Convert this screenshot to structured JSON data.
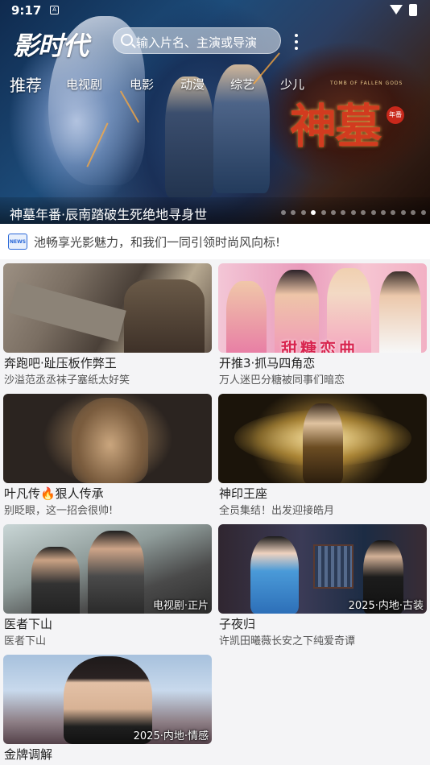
{
  "status_bar": {
    "time": "9:17",
    "sim_label": "A"
  },
  "app": {
    "logo": "影时代"
  },
  "search": {
    "placeholder": "输入片名、主演或导演"
  },
  "nav_tabs": [
    {
      "label": "推荐",
      "active": true
    },
    {
      "label": "电视剧",
      "active": false
    },
    {
      "label": "电影",
      "active": false
    },
    {
      "label": "动漫",
      "active": false
    },
    {
      "label": "综艺",
      "active": false
    },
    {
      "label": "少儿",
      "active": false
    }
  ],
  "hero": {
    "caption": "神墓年番·辰南踏破生死绝地寻身世",
    "art_title": "神墓",
    "art_subtitle": "TOMB OF FALLEN GODS",
    "art_seal": "年番",
    "slide_count": 15,
    "active_slide": 3
  },
  "notice": {
    "icon": "news-icon",
    "icon_label": "NEWS",
    "text": "池畅享光影魅力，和我们一同引领时尚风向标!"
  },
  "cards": [
    {
      "title": "奔跑吧·趾压板作弊王",
      "subtitle": "沙溢范丞丞袜子塞纸太好笑",
      "badge": ""
    },
    {
      "title": "开推3·抓马四角恋",
      "subtitle": "万人迷巴分糖被同事们暗恋",
      "badge": "",
      "thumb_text": "甜糖恋曲"
    },
    {
      "title": "叶凡传🔥狠人传承",
      "subtitle": "别眨眼，这一招会很帅!",
      "badge": ""
    },
    {
      "title": "神印王座",
      "subtitle": "全员集结！出发迎接皓月",
      "badge": ""
    },
    {
      "title": "医者下山",
      "subtitle": "医者下山",
      "badge": "电视剧·正片"
    },
    {
      "title": "子夜归",
      "subtitle": "许凯田曦薇长安之下纯爱奇谭",
      "badge": "2025·内地·古装"
    },
    {
      "title": "金牌调解",
      "subtitle": "",
      "badge": "2025·内地·情感"
    }
  ],
  "colors": {
    "accent_blue": "#2a68d8",
    "brand_red": "#d23b1f",
    "page_bg": "#f4f4f6"
  }
}
